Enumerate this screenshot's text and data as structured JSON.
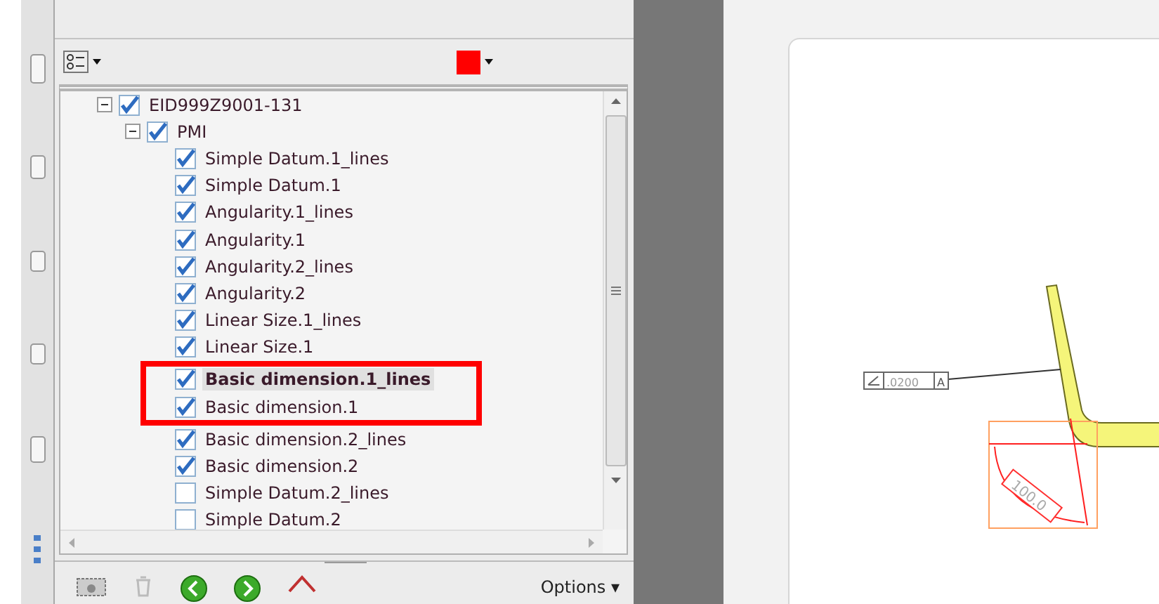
{
  "tree": {
    "label": "EID999Z9001-131",
    "checked": true,
    "expanded": true,
    "children": [
      {
        "label": "PMI",
        "checked": true,
        "expanded": true,
        "children": [
          {
            "label": "Simple Datum.1_lines",
            "checked": true,
            "selected": false,
            "highlighted": false
          },
          {
            "label": "Simple Datum.1",
            "checked": true,
            "selected": false,
            "highlighted": false
          },
          {
            "label": "Angularity.1_lines",
            "checked": true,
            "selected": false,
            "highlighted": false
          },
          {
            "label": "Angularity.1",
            "checked": true,
            "selected": false,
            "highlighted": false
          },
          {
            "label": "Angularity.2_lines",
            "checked": true,
            "selected": false,
            "highlighted": false
          },
          {
            "label": "Angularity.2",
            "checked": true,
            "selected": false,
            "highlighted": false
          },
          {
            "label": "Linear Size.1_lines",
            "checked": true,
            "selected": false,
            "highlighted": false
          },
          {
            "label": "Linear Size.1",
            "checked": true,
            "selected": false,
            "highlighted": false
          },
          {
            "label": "Basic dimension.1_lines",
            "checked": true,
            "selected": true,
            "highlighted": true
          },
          {
            "label": "Basic dimension.1",
            "checked": true,
            "selected": false,
            "highlighted": true
          },
          {
            "label": "Basic dimension.2_lines",
            "checked": true,
            "selected": false,
            "highlighted": false
          },
          {
            "label": "Basic dimension.2",
            "checked": true,
            "selected": false,
            "highlighted": false
          },
          {
            "label": "Simple Datum.2_lines",
            "checked": false,
            "selected": false,
            "highlighted": false
          },
          {
            "label": "Simple Datum.2",
            "checked": false,
            "selected": false,
            "highlighted": false
          }
        ]
      }
    ]
  },
  "footer": {
    "options": "Options ▾"
  },
  "drawing": {
    "tolerance": ".0200",
    "datum": "A",
    "dimension": "100.0"
  }
}
